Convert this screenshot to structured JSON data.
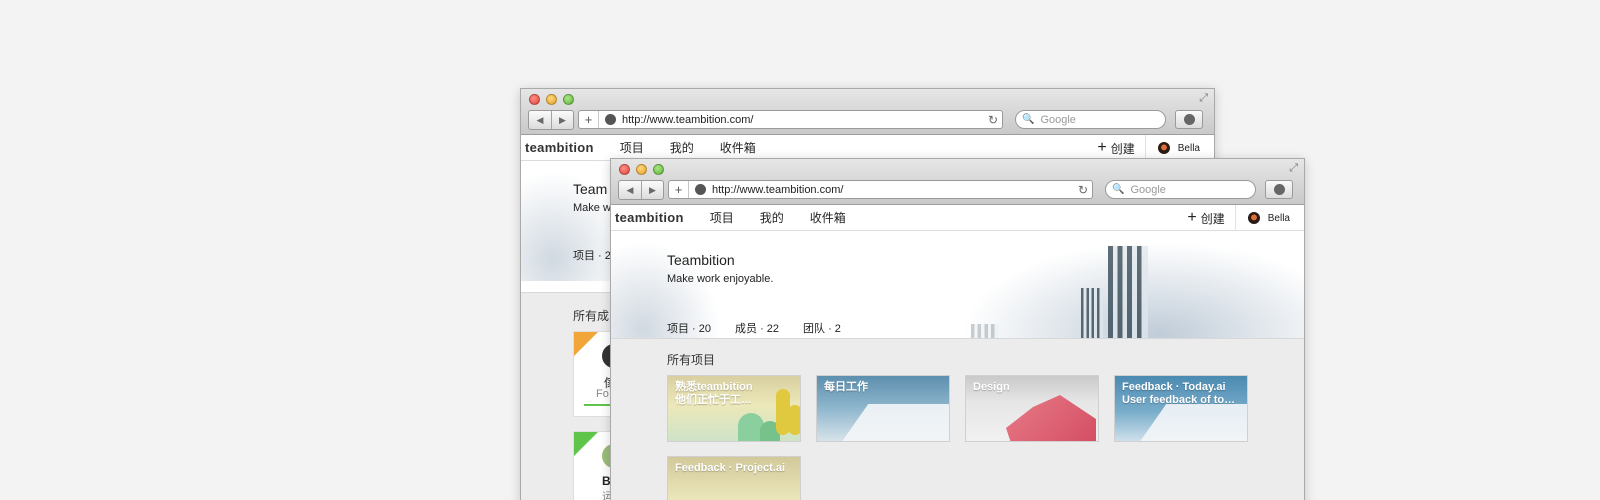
{
  "browser": {
    "url": "http://www.teambition.com/",
    "search_placeholder": "Google",
    "new_tab_label": "+",
    "reload_label": "↻",
    "back_label": "◀",
    "forward_label": "▶",
    "resize_label": "⤢"
  },
  "app": {
    "brand": "teambition",
    "nav": [
      "项目",
      "我的",
      "收件箱"
    ],
    "create_label": "创建",
    "create_icon": "+",
    "user_name": "Bella"
  },
  "back_window": {
    "hero_title_partial": "Team",
    "hero_sub_partial": "Make w",
    "tab_partial": "项目 · 2",
    "section_partial": "所有成",
    "member1_name_partial": "傢",
    "member1_sub_partial": "Fo",
    "member2_name_partial": "B",
    "member2_sub_partial": "运"
  },
  "front_window": {
    "hero_title": "Teambition",
    "hero_subtitle": "Make work enjoyable.",
    "tabs": [
      "项目 · 20",
      "成员 · 22",
      "团队 · 2"
    ],
    "section_title": "所有项目",
    "projects": [
      {
        "line1": "熟悉teambition",
        "line2": "他们正忙于工…"
      },
      {
        "line1": "每日工作",
        "line2": ""
      },
      {
        "line1": "Design",
        "line2": ""
      },
      {
        "line1": "Feedback · Today.ai",
        "line2": "User feedback of to…"
      },
      {
        "line1": "Feedback · Project.ai",
        "line2": ""
      }
    ]
  }
}
